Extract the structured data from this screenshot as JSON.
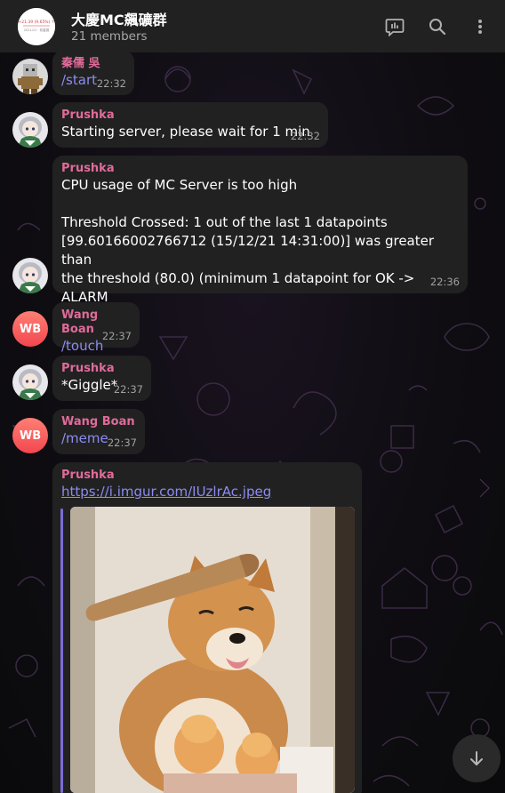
{
  "header": {
    "title": "大慶MC飆礦群",
    "subtitle": "21 members",
    "group_avatar_text_1": "+21.39 (9.65%) ↑",
    "group_avatar_text_2": "2021/12 · 收盤價"
  },
  "messages": [
    {
      "sender": "秦儒 吳",
      "sender_color": "#e06b9a",
      "text": "/start",
      "time": "22:32"
    },
    {
      "sender": "Prushka",
      "sender_color": "#e06b9a",
      "text": "Starting server, please wait for 1 min",
      "time": "22:32"
    },
    {
      "sender": "Prushka",
      "sender_color": "#e06b9a",
      "lines": [
        "CPU usage of MC Server is too high",
        "",
        "Threshold Crossed: 1 out of the last 1 datapoints",
        "[99.60166002766712 (15/12/21 14:31:00)] was greater than",
        "the threshold (80.0) (minimum 1 datapoint for OK -> ALARM",
        "transition)."
      ],
      "time": "22:36"
    },
    {
      "sender": "Wang Boan",
      "sender_color": "#e06b9a",
      "text": "/touch",
      "time": "22:37",
      "avatar_initials": "WB"
    },
    {
      "sender": "Prushka",
      "sender_color": "#e06b9a",
      "text": "*Giggle*",
      "time": "22:37"
    },
    {
      "sender": "Wang Boan",
      "sender_color": "#e06b9a",
      "text": "/meme",
      "time": "22:37",
      "avatar_initials": "WB"
    },
    {
      "sender": "Prushka",
      "sender_color": "#e06b9a",
      "link": "https://i.imgur.com/IUzlrAc.jpeg"
    }
  ],
  "colors": {
    "accent": "#8c8cf0",
    "sender": "#e06b9a",
    "bubble": "#212121",
    "header": "#212121"
  },
  "icons": [
    "poll-icon",
    "search-icon",
    "more-vertical-icon",
    "arrow-down-icon"
  ]
}
